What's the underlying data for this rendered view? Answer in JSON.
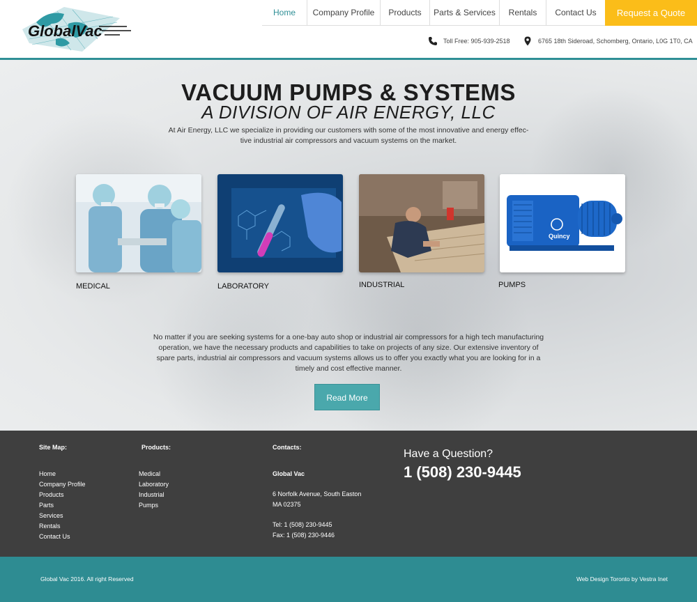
{
  "brand": {
    "logo_text": "GlobalVac"
  },
  "nav": {
    "items": [
      "Home",
      "Company Profile",
      "Products",
      "Parts & Services",
      "Rentals",
      "Contact Us"
    ],
    "cta": "Request a Quote"
  },
  "contact_bar": {
    "phone": "Toll Free:  905-939-2518",
    "address": "6765 18th Sideroad, Schomberg, Ontario, L0G 1T0, CA"
  },
  "hero": {
    "title": "VACUUM PUMPS & SYSTEMS",
    "subtitle": "A DIVISION OF AIR ENERGY, LLC",
    "intro": "At Air Energy, LLC  we specialize in providing our customers with some of the most innovative and energy effec- tive industrial air compressors and vacuum systems on the market."
  },
  "categories": [
    "MEDICAL",
    "LABORATORY",
    "INDUSTRIAL",
    "PUMPS"
  ],
  "pump_brand": "Quincy",
  "body": {
    "text": "No matter if you are seeking systems for a one-bay auto shop or industrial air compressors for a high tech manufacturing operation, we have the necessary products and capabilities to take on projects of any size.  Our extensive inventory of spare parts, industrial air compressors and vacuum systems allows us to offer you exactly what you are looking for in a timely and cost effective manner.",
    "button": "Read More"
  },
  "footer": {
    "sitemap_title": "Site Map:",
    "sitemap": [
      "Home",
      "Company Profile",
      "Products",
      "Parts",
      "Services",
      "Rentals",
      "Contact Us"
    ],
    "products_title": "Products:",
    "products": [
      "Medical",
      "Laboratory",
      "Industrial",
      "Pumps"
    ],
    "contacts_title": "Contacts:",
    "company": "Global Vac",
    "address1": "6 Norfolk Avenue, South Easton",
    "address2": "MA 02375",
    "tel": "Tel: 1 (508) 230-9445",
    "fax": "Fax: 1 (508) 230-9446",
    "question": "Have a Question?",
    "big_phone": "1 (508) 230-9445"
  },
  "bottom": {
    "copyright": "Global Vac  2016. All right Reserved",
    "credit": "Web Design Toronto by Vestra Inet"
  },
  "colors": {
    "accent": "#2e8c92",
    "cta": "#fbbd19",
    "footer": "#3f3f3f",
    "button": "#4aa8ac"
  }
}
